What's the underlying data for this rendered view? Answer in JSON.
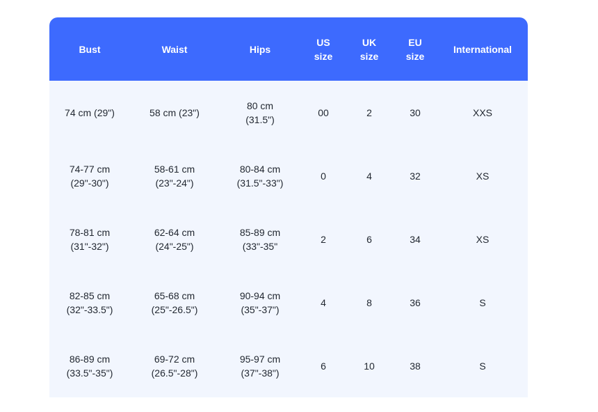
{
  "headers": [
    [
      "Bust"
    ],
    [
      "Waist"
    ],
    [
      "Hips"
    ],
    [
      "US",
      "size"
    ],
    [
      "UK",
      "size"
    ],
    [
      "EU",
      "size"
    ],
    [
      "International"
    ]
  ],
  "rows": [
    [
      [
        "74 cm (29\")"
      ],
      [
        "58 cm (23\")"
      ],
      [
        "80 cm",
        "(31.5\")"
      ],
      [
        "00"
      ],
      [
        "2"
      ],
      [
        "30"
      ],
      [
        "XXS"
      ]
    ],
    [
      [
        "74-77 cm",
        "(29\"-30\")"
      ],
      [
        "58-61 cm",
        "(23\"-24\")"
      ],
      [
        "80-84 cm",
        "(31.5\"-33\")"
      ],
      [
        "0"
      ],
      [
        "4"
      ],
      [
        "32"
      ],
      [
        "XS"
      ]
    ],
    [
      [
        "78-81 cm",
        "(31\"-32\")"
      ],
      [
        "62-64 cm",
        "(24\"-25\")"
      ],
      [
        "85-89 cm",
        "(33\"-35\""
      ],
      [
        "2"
      ],
      [
        "6"
      ],
      [
        "34"
      ],
      [
        "XS"
      ]
    ],
    [
      [
        "82-85 cm",
        "(32\"-33.5\")"
      ],
      [
        "65-68 cm",
        "(25\"-26.5\")"
      ],
      [
        "90-94 cm",
        "(35\"-37\")"
      ],
      [
        "4"
      ],
      [
        "8"
      ],
      [
        "36"
      ],
      [
        "S"
      ]
    ],
    [
      [
        "86-89 cm",
        "(33.5\"-35\")"
      ],
      [
        "69-72 cm",
        "(26.5\"-28\")"
      ],
      [
        "95-97 cm",
        "(37\"-38\")"
      ],
      [
        "6"
      ],
      [
        "10"
      ],
      [
        "38"
      ],
      [
        "S"
      ]
    ]
  ],
  "colors": {
    "header_bg": "#3d6afe",
    "header_text": "#ffffff",
    "body_bg": "#f2f6fe",
    "body_text": "#222831"
  }
}
